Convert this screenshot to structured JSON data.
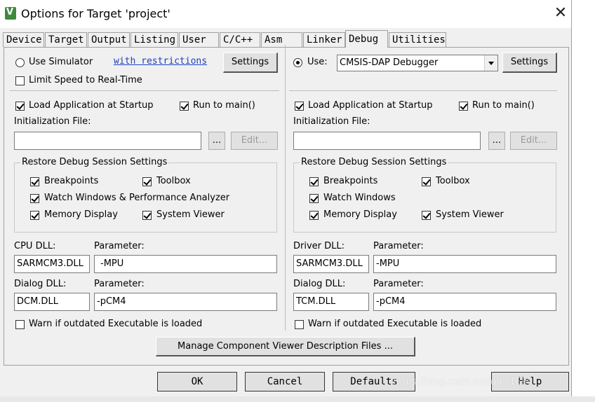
{
  "window": {
    "title": "Options for Target 'project'"
  },
  "tabs": [
    "Device",
    "Target",
    "Output",
    "Listing",
    "User",
    "C/C++",
    "Asm",
    "Linker",
    "Debug",
    "Utilities"
  ],
  "active_tab": "Debug",
  "left": {
    "use_simulator": "Use Simulator",
    "with_restrictions": "with restrictions",
    "settings": "Settings",
    "limit_speed": "Limit Speed to Real-Time",
    "load_app": "Load Application at Startup",
    "run_to_main": "Run to main()",
    "init_file_label": "Initialization File:",
    "init_file_value": "",
    "browse": "...",
    "edit": "Edit...",
    "restore_group": "Restore Debug Session Settings",
    "breakpoints": "Breakpoints",
    "toolbox": "Toolbox",
    "watch_windows": "Watch Windows & Performance Analyzer",
    "memory_display": "Memory Display",
    "system_viewer": "System Viewer",
    "cpu_dll_label": "CPU DLL:",
    "cpu_dll_value": "SARMCM3.DLL",
    "cpu_param_label": "Parameter:",
    "cpu_param_value": "-MPU",
    "dialog_dll_label": "Dialog DLL:",
    "dialog_dll_value": "DCM.DLL",
    "dialog_param_label": "Parameter:",
    "dialog_param_value": "-pCM4",
    "warn_outdated": "Warn if outdated Executable is loaded"
  },
  "right": {
    "use_label": "Use:",
    "debugger": "CMSIS-DAP Debugger",
    "settings": "Settings",
    "load_app": "Load Application at Startup",
    "run_to_main": "Run to main()",
    "init_file_label": "Initialization File:",
    "init_file_value": "",
    "browse": "...",
    "edit": "Edit...",
    "restore_group": "Restore Debug Session Settings",
    "breakpoints": "Breakpoints",
    "toolbox": "Toolbox",
    "watch_windows": "Watch Windows",
    "memory_display": "Memory Display",
    "system_viewer": "System Viewer",
    "driver_dll_label": "Driver DLL:",
    "driver_dll_value": "SARMCM3.DLL",
    "driver_param_label": "Parameter:",
    "driver_param_value": "-MPU",
    "dialog_dll_label": "Dialog DLL:",
    "dialog_dll_value": "TCM.DLL",
    "dialog_param_label": "Parameter:",
    "dialog_param_value": "-pCM4",
    "warn_outdated": "Warn if outdated Executable is loaded"
  },
  "manage_button": "Manage Component Viewer Description Files ...",
  "footer": {
    "ok": "OK",
    "cancel": "Cancel",
    "defaults": "Defaults",
    "help": "Help"
  },
  "watermark": "https://blog.csdn.net/qq_      1690"
}
